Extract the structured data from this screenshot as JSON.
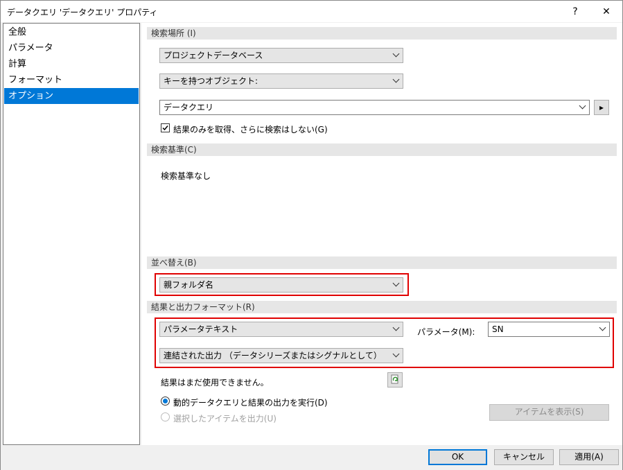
{
  "window": {
    "title": "データクエリ 'データクエリ' プロパティ",
    "help": "?",
    "close": "✕"
  },
  "nav": {
    "items": [
      "全般",
      "パラメータ",
      "計算",
      "フォーマット",
      "オプション"
    ],
    "selected": "オプション"
  },
  "search_location": {
    "header": "検索場所 (I)",
    "combo1": "プロジェクトデータベース",
    "combo2": "キーを持つオブジェクト:",
    "combo3": "データクエリ",
    "arrow_button": "▸",
    "checkbox_label": "結果のみを取得、さらに検索はしない(G)",
    "checked": true
  },
  "criteria": {
    "header": "検索基準(C)",
    "text": "検索基準なし"
  },
  "sort": {
    "header": "並べ替え(B)",
    "value": "親フォルダ名"
  },
  "output": {
    "header": "結果と出力フォーマット(R)",
    "format": "パラメータテキスト",
    "param_label": "パラメータ(M):",
    "param_value": "SN",
    "mode": "連結された出力 （データシリーズまたはシグナルとして）",
    "status": "結果はまだ使用できません。",
    "radio1": "動的データクエリと結果の出力を実行(D)",
    "radio2": "選択したアイテムを出力(U)",
    "show_items": "アイテムを表示(S)"
  },
  "buttons": {
    "ok": "OK",
    "cancel": "キャンセル",
    "apply": "適用(A)"
  }
}
